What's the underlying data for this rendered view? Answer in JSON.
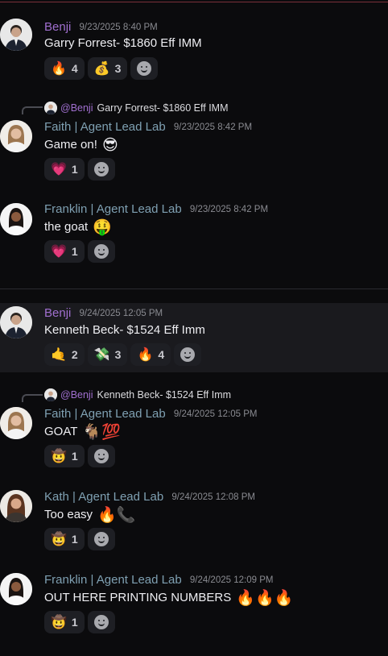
{
  "messages": [
    {
      "author": "Benji",
      "timestamp": "9/23/2025 8:40 PM",
      "text": "Garry Forrest- $1860 Eff IMM",
      "reactions": [
        {
          "emoji": "🔥",
          "count": "4",
          "icon": "fire-icon"
        },
        {
          "emoji": "💰",
          "count": "3",
          "icon": "money-bag-icon"
        }
      ]
    },
    {
      "reply": {
        "user": "@Benji",
        "text": "Garry Forrest- $1860 Eff IMM"
      },
      "author": "Faith | Agent Lead Lab",
      "timestamp": "9/23/2025 8:42 PM",
      "text": "Game on!",
      "text_emoji": "😎",
      "reactions": [
        {
          "emoji": "💗",
          "count": "1",
          "icon": "heart-icon"
        }
      ]
    },
    {
      "author": "Franklin | Agent Lead Lab",
      "timestamp": "9/23/2025 8:42 PM",
      "text": "the goat",
      "text_emoji": "🤑",
      "reactions": [
        {
          "emoji": "💗",
          "count": "1",
          "icon": "heart-icon"
        }
      ]
    },
    {
      "author": "Benji",
      "timestamp": "9/24/2025 12:05 PM",
      "text": "Kenneth Beck- $1524 Eff Imm",
      "reactions": [
        {
          "emoji": "🤙",
          "count": "2",
          "icon": "call-me-hand-icon"
        },
        {
          "emoji": "💸",
          "count": "3",
          "icon": "money-wings-icon"
        },
        {
          "emoji": "🔥",
          "count": "4",
          "icon": "fire-icon"
        }
      ]
    },
    {
      "reply": {
        "user": "@Benji",
        "text": "Kenneth Beck- $1524 Eff Imm"
      },
      "author": "Faith | Agent Lead Lab",
      "timestamp": "9/24/2025 12:05 PM",
      "text": "GOAT",
      "text_emoji": "🐐💯",
      "reactions": [
        {
          "emoji": "🤠",
          "count": "1",
          "icon": "cowboy-icon"
        }
      ]
    },
    {
      "author": "Kath | Agent Lead Lab",
      "timestamp": "9/24/2025 12:08 PM",
      "text": "Too easy",
      "text_emoji": "🔥📞",
      "reactions": [
        {
          "emoji": "🤠",
          "count": "1",
          "icon": "cowboy-icon"
        }
      ]
    },
    {
      "author": "Franklin | Agent Lead Lab",
      "timestamp": "9/24/2025 12:09 PM",
      "text": "OUT HERE PRINTING NUMBERS",
      "text_emoji": "🔥🔥🔥",
      "reactions": [
        {
          "emoji": "🤠",
          "count": "1",
          "icon": "cowboy-icon"
        }
      ]
    }
  ],
  "colors": {
    "background": "#0b0b0d",
    "author_benji": "#a06fcf",
    "author_agent": "#7fa0b2",
    "timestamp": "#8a8b91",
    "reaction_bg": "#1e1f24"
  }
}
